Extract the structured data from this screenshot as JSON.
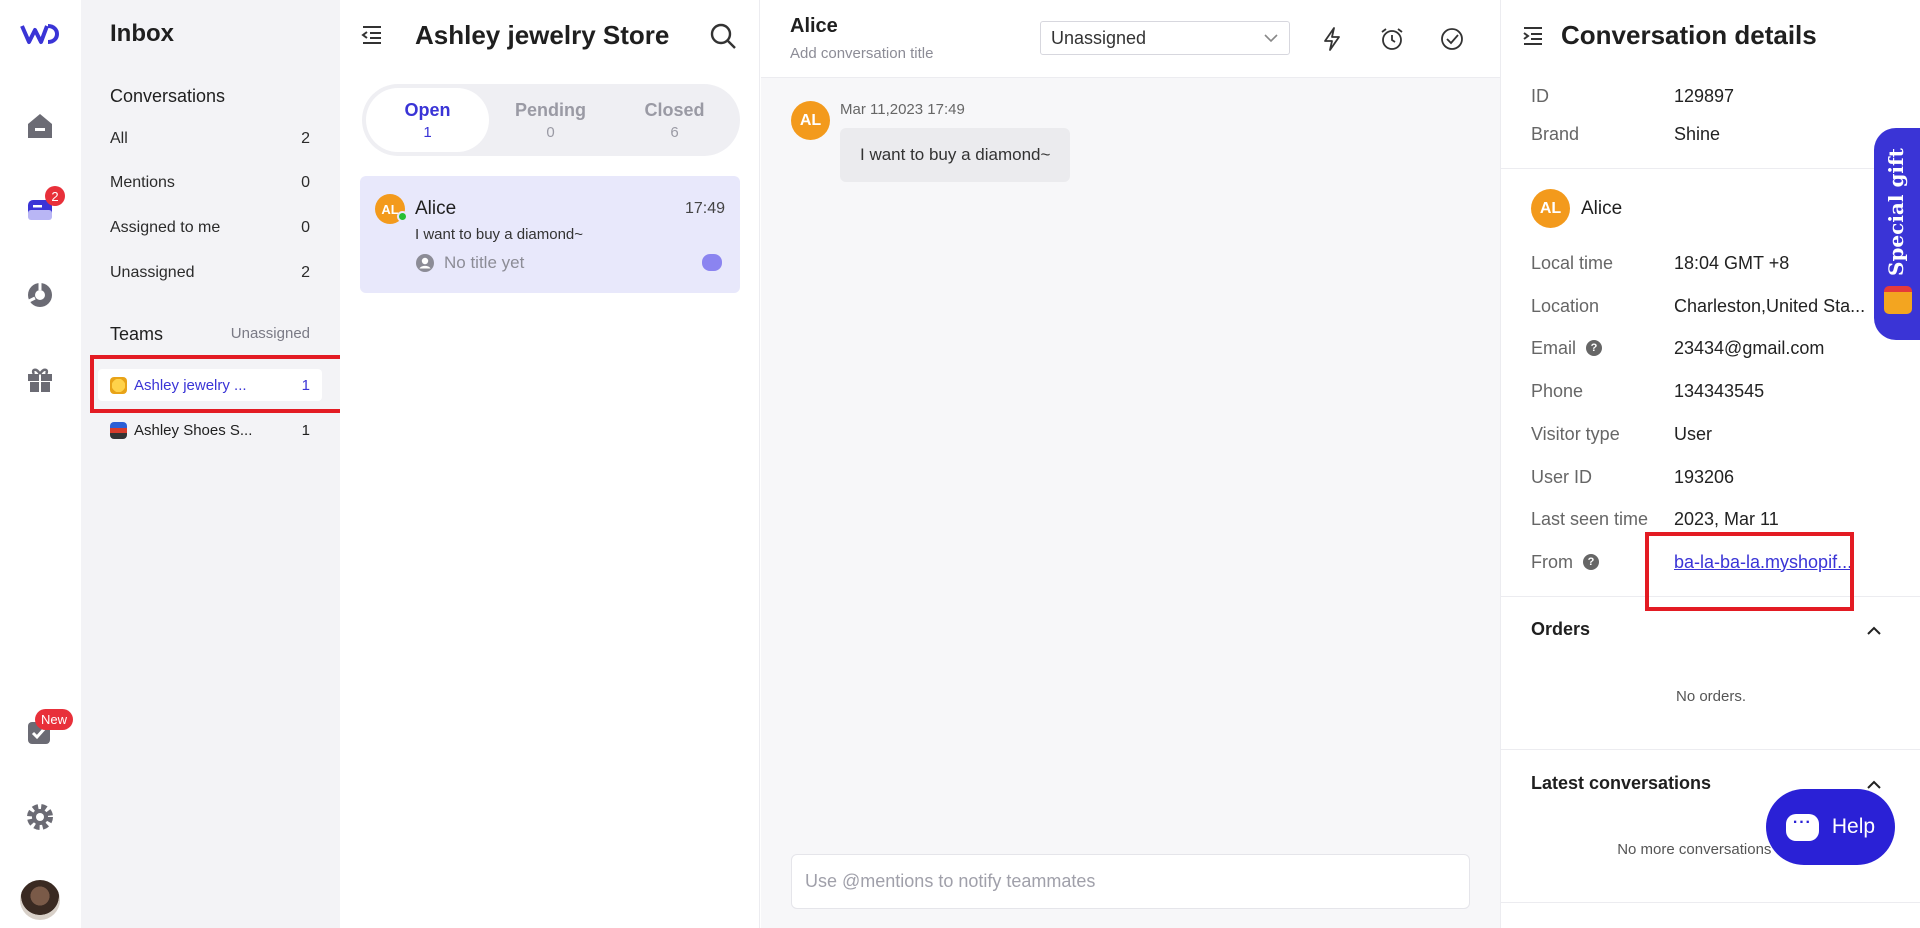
{
  "badges": {
    "messages_count": "2",
    "new_label": "New"
  },
  "inbox": {
    "title": "Inbox",
    "conversations_heading": "Conversations",
    "items": [
      {
        "label": "All",
        "count": "2"
      },
      {
        "label": "Mentions",
        "count": "0"
      },
      {
        "label": "Assigned to me",
        "count": "0"
      },
      {
        "label": "Unassigned",
        "count": "2"
      }
    ],
    "teams_heading": "Teams",
    "teams_right": "Unassigned",
    "teams": [
      {
        "label": "Ashley jewelry ...",
        "count": "1",
        "active": true
      },
      {
        "label": "Ashley Shoes S...",
        "count": "1",
        "active": false
      }
    ]
  },
  "conversation_list": {
    "title": "Ashley jewelry Store",
    "tabs": [
      {
        "label": "Open",
        "count": "1"
      },
      {
        "label": "Pending",
        "count": "0"
      },
      {
        "label": "Closed",
        "count": "6"
      }
    ],
    "card": {
      "initials": "AL",
      "name": "Alice",
      "time": "17:49",
      "message": "I want to buy a diamond~",
      "title": "No title yet"
    }
  },
  "chat": {
    "name": "Alice",
    "subtitle": "Add conversation title",
    "assignee": "Unassigned",
    "message": {
      "initials": "AL",
      "timestamp": "Mar 11,2023 17:49",
      "text": "I want to buy a diamond~"
    },
    "composer_placeholder": "Use @mentions to notify teammates"
  },
  "details": {
    "title": "Conversation details",
    "id_label": "ID",
    "id_value": "129897",
    "brand_label": "Brand",
    "brand_value": "Shine",
    "contact_initials": "AL",
    "contact_name": "Alice",
    "fields": {
      "local_time_label": "Local time",
      "local_time_value": "18:04 GMT +8",
      "location_label": "Location",
      "location_value": "Charleston,United Sta...",
      "email_label": "Email",
      "email_value": "23434@gmail.com",
      "phone_label": "Phone",
      "phone_value": "134343545",
      "visitor_type_label": "Visitor type",
      "visitor_type_value": "User",
      "user_id_label": "User ID",
      "user_id_value": "193206",
      "last_seen_label": "Last seen time",
      "last_seen_value": "2023, Mar 11",
      "from_label": "From",
      "from_value": "ba-la-ba-la.myshopif..."
    },
    "orders_heading": "Orders",
    "orders_empty": "No orders.",
    "latest_heading": "Latest conversations",
    "latest_empty": "No more conversations at th"
  },
  "special_gift": "Special gift",
  "help_label": "Help",
  "colors": {
    "accent": "#3a34d6",
    "highlight": "#e31b23",
    "badge": "#e8303a",
    "avatar": "#f39a1c"
  }
}
